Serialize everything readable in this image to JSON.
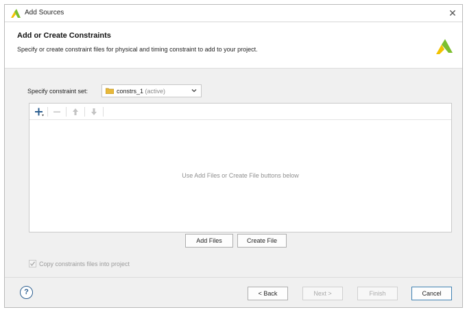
{
  "window": {
    "title": "Add Sources",
    "close_glyph": "✕"
  },
  "header": {
    "title": "Add or Create Constraints",
    "description": "Specify or create constraint files for physical and timing constraint to add to your project."
  },
  "constraint_set": {
    "label": "Specify constraint set:",
    "value": "constrs_1",
    "status": "(active)"
  },
  "table": {
    "toolbar": {
      "add_icon": "plus-icon",
      "remove_icon": "minus-icon",
      "up_icon": "arrow-up-icon",
      "down_icon": "arrow-down-icon"
    },
    "empty_message": "Use Add Files or Create File buttons below"
  },
  "actions": {
    "add_files": "Add Files",
    "create_file": "Create File"
  },
  "copy_option": {
    "label": "Copy constraints files into project",
    "checked": true
  },
  "footer": {
    "help": "?",
    "back": "< Back",
    "next": "Next >",
    "finish": "Finish",
    "cancel": "Cancel"
  },
  "colors": {
    "accent": "#3c7fb1",
    "logo_green": "#7cbf2f",
    "logo_yellow": "#f2c200"
  }
}
